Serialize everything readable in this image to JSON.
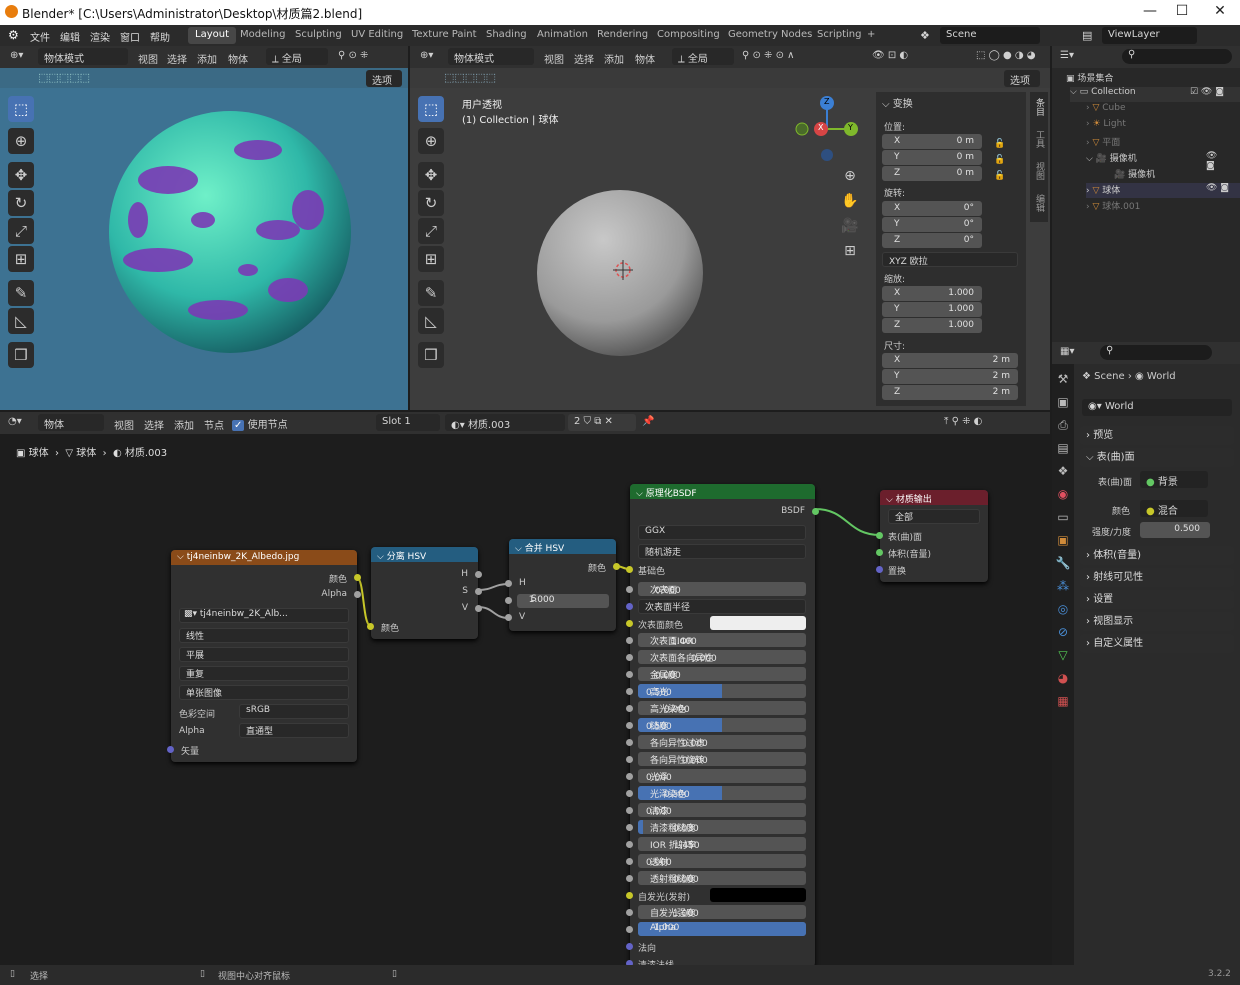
{
  "window": {
    "title": "Blender* [C:\\Users\\Administrator\\Desktop\\材质篇2.blend]",
    "min": "—",
    "max": "☐",
    "close": "✕"
  },
  "menus": [
    "文件",
    "编辑",
    "渲染",
    "窗口",
    "帮助"
  ],
  "workspaces": [
    "Layout",
    "Modeling",
    "Sculpting",
    "UV Editing",
    "Texture Paint",
    "Shading",
    "Animation",
    "Rendering",
    "Compositing",
    "Geometry Nodes",
    "Scripting",
    "+"
  ],
  "scene": "Scene",
  "viewlayer": "ViewLayer",
  "vp1": {
    "mode": "物体模式",
    "menus": [
      "视图",
      "选择",
      "添加",
      "物体"
    ],
    "global": "全局",
    "options": "选项"
  },
  "vp2": {
    "mode": "物体模式",
    "menus": [
      "视图",
      "选择",
      "添加",
      "物体"
    ],
    "global": "全局",
    "options": "选项",
    "persp": "用户透视",
    "collection": "(1) Collection | 球体"
  },
  "npanel": {
    "title": "变换",
    "loc": "位置:",
    "rot": "旋转:",
    "scale": "缩放:",
    "dims": "尺寸:",
    "x": "X",
    "y": "Y",
    "z": "Z",
    "loc_vals": [
      "0 m",
      "0 m",
      "0 m"
    ],
    "rot_vals": [
      "0°",
      "0°",
      "0°"
    ],
    "rot_mode": "XYZ 欧拉",
    "scale_vals": [
      "1.000",
      "1.000",
      "1.000"
    ],
    "dim_vals": [
      "2 m",
      "2 m",
      "2 m"
    ],
    "tabs": [
      "条目",
      "工具",
      "视图",
      "编辑"
    ]
  },
  "gizmo": {
    "x": "X",
    "y": "Y",
    "z": "Z"
  },
  "outliner": {
    "root": "场景集合",
    "collection": "Collection",
    "items": [
      {
        "name": "Cube"
      },
      {
        "name": "Light"
      },
      {
        "name": "平面"
      },
      {
        "name": "摄像机"
      },
      {
        "name": "摄像机"
      },
      {
        "name": "球体"
      },
      {
        "name": "球体.001"
      }
    ]
  },
  "props": {
    "scene": "Scene",
    "world": "World",
    "world_field": "World",
    "sections": [
      "预览",
      "表(曲)面",
      "体积(音量)",
      "射线可见性",
      "设置",
      "视图显示",
      "自定义属性"
    ],
    "surface_label": "表(曲)面",
    "surface_val": "背景",
    "color_label": "颜色",
    "color_val": "混合",
    "strength_label": "强度/力度",
    "strength_val": "0.500"
  },
  "nodeeditor": {
    "type": "物体",
    "menus": [
      "视图",
      "选择",
      "添加",
      "节点"
    ],
    "use_nodes": "使用节点",
    "slot": "Slot 1",
    "material": "材质.003",
    "users": "2",
    "breadcrumb": [
      "球体",
      "球体",
      "材质.003"
    ]
  },
  "node_img": {
    "title": "tj4neinbw_2K_Albedo.jpg",
    "out_color": "颜色",
    "out_alpha": "Alpha",
    "image": "tj4neinbw_2K_Alb...",
    "interp": "线性",
    "proj": "平展",
    "ext": "重复",
    "source": "单张图像",
    "cs_label": "色彩空间",
    "cs_val": "sRGB",
    "alpha_label": "Alpha",
    "alpha_val": "直通型",
    "vector": "矢量"
  },
  "node_sep": {
    "title": "分离 HSV",
    "h": "H",
    "s": "S",
    "v": "V",
    "in": "颜色"
  },
  "node_comb": {
    "title": "合并 HSV",
    "out": "颜色",
    "h": "H",
    "s": "S",
    "s_val": "1.000",
    "v": "V"
  },
  "node_bsdf": {
    "title": "原理化BSDF",
    "out": "BSDF",
    "dist": "GGX",
    "sss": "随机游走",
    "base": "基础色",
    "rows": [
      {
        "label": "次表面",
        "val": "0.000",
        "fill": 0
      },
      {
        "label": "次表面半径",
        "val": "",
        "fill": -1
      },
      {
        "label": "次表面颜色",
        "val": "",
        "fill": -2
      },
      {
        "label": "次表面IOR",
        "val": "1.400",
        "fill": 0
      },
      {
        "label": "次表面各向异性",
        "val": "0.000",
        "fill": 0
      },
      {
        "label": "金属度",
        "val": "0.000",
        "fill": 0
      },
      {
        "label": "高光",
        "val": "0.500",
        "fill": 0.5
      },
      {
        "label": "高光染色",
        "val": "0.000",
        "fill": 0
      },
      {
        "label": "糙度",
        "val": "0.500",
        "fill": 0.5
      },
      {
        "label": "各向异性过滤",
        "val": "0.000",
        "fill": 0
      },
      {
        "label": "各向异性旋转",
        "val": "0.000",
        "fill": 0
      },
      {
        "label": "光泽",
        "val": "0.000",
        "fill": 0
      },
      {
        "label": "光泽染色",
        "val": "0.500",
        "fill": 0.5
      },
      {
        "label": "清漆",
        "val": "0.000",
        "fill": 0
      },
      {
        "label": "清漆粗糙度",
        "val": "0.030",
        "fill": 0.03
      },
      {
        "label": "IOR 折射率",
        "val": "1.450",
        "fill": 0
      },
      {
        "label": "透射",
        "val": "0.000",
        "fill": 0
      },
      {
        "label": "透射粗糙度",
        "val": "0.000",
        "fill": 0
      },
      {
        "label": "自发光(发射)",
        "val": "",
        "fill": -3
      },
      {
        "label": "自发光强度",
        "val": "1.000",
        "fill": 0
      },
      {
        "label": "Alpha",
        "val": "1.000",
        "fill": 1
      },
      {
        "label": "法向",
        "val": "",
        "fill": -4
      },
      {
        "label": "清漆法线",
        "val": "",
        "fill": -4
      }
    ]
  },
  "node_out": {
    "title": "材质输出",
    "target": "全部",
    "surface": "表(曲)面",
    "volume": "体积(音量)",
    "disp": "置换"
  },
  "status": {
    "select": "选择",
    "center": "视图中心对齐鼠标",
    "version": "3.2.2"
  },
  "colors": {
    "accent": "#4772b3",
    "bsdf_header": "#1e6b2e",
    "output_header": "#6b1f2c",
    "img_header": "#8a4b19",
    "hsv_header": "#245d80"
  }
}
